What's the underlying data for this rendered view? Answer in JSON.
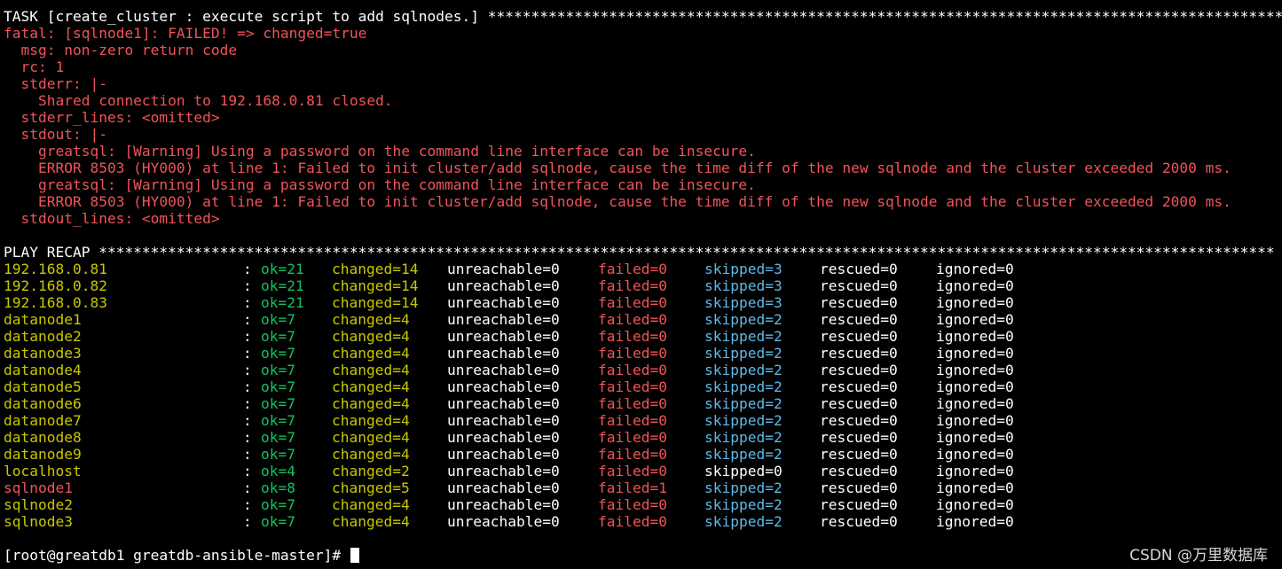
{
  "task_header": "TASK [create_cluster : execute script to add sqlnodes.] **********************************************************************************************",
  "error_lines": [
    "fatal: [sqlnode1]: FAILED! => changed=true",
    "  msg: non-zero return code",
    "  rc: 1",
    "  stderr: |-",
    "    Shared connection to 192.168.0.81 closed.",
    "  stderr_lines: <omitted>",
    "  stdout: |-",
    "    greatsql: [Warning] Using a password on the command line interface can be insecure.",
    "    ERROR 8503 (HY000) at line 1: Failed to init cluster/add sqlnode, cause the time diff of the new sqlnode and the cluster exceeded 2000 ms.",
    "    greatsql: [Warning] Using a password on the command line interface can be insecure.",
    "    ERROR 8503 (HY000) at line 1: Failed to init cluster/add sqlnode, cause the time diff of the new sqlnode and the cluster exceeded 2000 ms.",
    "  stdout_lines: <omitted>"
  ],
  "recap_header": "PLAY RECAP ****************************************************************************************************************************************",
  "recap": [
    {
      "host": "192.168.0.81",
      "host_color": "yellow",
      "ok": "ok=21",
      "changed": "changed=14",
      "unreachable": "unreachable=0",
      "failed": "failed=0",
      "skipped": "skipped=3",
      "skipped_color": "cyan",
      "rescued": "rescued=0",
      "ignored": "ignored=0"
    },
    {
      "host": "192.168.0.82",
      "host_color": "yellow",
      "ok": "ok=21",
      "changed": "changed=14",
      "unreachable": "unreachable=0",
      "failed": "failed=0",
      "skipped": "skipped=3",
      "skipped_color": "cyan",
      "rescued": "rescued=0",
      "ignored": "ignored=0"
    },
    {
      "host": "192.168.0.83",
      "host_color": "yellow",
      "ok": "ok=21",
      "changed": "changed=14",
      "unreachable": "unreachable=0",
      "failed": "failed=0",
      "skipped": "skipped=3",
      "skipped_color": "cyan",
      "rescued": "rescued=0",
      "ignored": "ignored=0"
    },
    {
      "host": "datanode1",
      "host_color": "yellow",
      "ok": "ok=7",
      "changed": "changed=4",
      "unreachable": "unreachable=0",
      "failed": "failed=0",
      "skipped": "skipped=2",
      "skipped_color": "cyan",
      "rescued": "rescued=0",
      "ignored": "ignored=0"
    },
    {
      "host": "datanode2",
      "host_color": "yellow",
      "ok": "ok=7",
      "changed": "changed=4",
      "unreachable": "unreachable=0",
      "failed": "failed=0",
      "skipped": "skipped=2",
      "skipped_color": "cyan",
      "rescued": "rescued=0",
      "ignored": "ignored=0"
    },
    {
      "host": "datanode3",
      "host_color": "yellow",
      "ok": "ok=7",
      "changed": "changed=4",
      "unreachable": "unreachable=0",
      "failed": "failed=0",
      "skipped": "skipped=2",
      "skipped_color": "cyan",
      "rescued": "rescued=0",
      "ignored": "ignored=0"
    },
    {
      "host": "datanode4",
      "host_color": "yellow",
      "ok": "ok=7",
      "changed": "changed=4",
      "unreachable": "unreachable=0",
      "failed": "failed=0",
      "skipped": "skipped=2",
      "skipped_color": "cyan",
      "rescued": "rescued=0",
      "ignored": "ignored=0"
    },
    {
      "host": "datanode5",
      "host_color": "yellow",
      "ok": "ok=7",
      "changed": "changed=4",
      "unreachable": "unreachable=0",
      "failed": "failed=0",
      "skipped": "skipped=2",
      "skipped_color": "cyan",
      "rescued": "rescued=0",
      "ignored": "ignored=0"
    },
    {
      "host": "datanode6",
      "host_color": "yellow",
      "ok": "ok=7",
      "changed": "changed=4",
      "unreachable": "unreachable=0",
      "failed": "failed=0",
      "skipped": "skipped=2",
      "skipped_color": "cyan",
      "rescued": "rescued=0",
      "ignored": "ignored=0"
    },
    {
      "host": "datanode7",
      "host_color": "yellow",
      "ok": "ok=7",
      "changed": "changed=4",
      "unreachable": "unreachable=0",
      "failed": "failed=0",
      "skipped": "skipped=2",
      "skipped_color": "cyan",
      "rescued": "rescued=0",
      "ignored": "ignored=0"
    },
    {
      "host": "datanode8",
      "host_color": "yellow",
      "ok": "ok=7",
      "changed": "changed=4",
      "unreachable": "unreachable=0",
      "failed": "failed=0",
      "skipped": "skipped=2",
      "skipped_color": "cyan",
      "rescued": "rescued=0",
      "ignored": "ignored=0"
    },
    {
      "host": "datanode9",
      "host_color": "yellow",
      "ok": "ok=7",
      "changed": "changed=4",
      "unreachable": "unreachable=0",
      "failed": "failed=0",
      "skipped": "skipped=2",
      "skipped_color": "cyan",
      "rescued": "rescued=0",
      "ignored": "ignored=0"
    },
    {
      "host": "localhost",
      "host_color": "yellow",
      "ok": "ok=4",
      "changed": "changed=2",
      "unreachable": "unreachable=0",
      "failed": "failed=0",
      "skipped": "skipped=0",
      "skipped_color": "white",
      "rescued": "rescued=0",
      "ignored": "ignored=0"
    },
    {
      "host": "sqlnode1",
      "host_color": "red",
      "ok": "ok=8",
      "changed": "changed=5",
      "unreachable": "unreachable=0",
      "failed": "failed=1",
      "skipped": "skipped=2",
      "skipped_color": "cyan",
      "rescued": "rescued=0",
      "ignored": "ignored=0"
    },
    {
      "host": "sqlnode2",
      "host_color": "yellow",
      "ok": "ok=7",
      "changed": "changed=4",
      "unreachable": "unreachable=0",
      "failed": "failed=0",
      "skipped": "skipped=2",
      "skipped_color": "cyan",
      "rescued": "rescued=0",
      "ignored": "ignored=0"
    },
    {
      "host": "sqlnode3",
      "host_color": "yellow",
      "ok": "ok=7",
      "changed": "changed=4",
      "unreachable": "unreachable=0",
      "failed": "failed=0",
      "skipped": "skipped=2",
      "skipped_color": "cyan",
      "rescued": "rescued=0",
      "ignored": "ignored=0"
    }
  ],
  "prompt": "[root@greatdb1 greatdb-ansible-master]# ",
  "watermark": "CSDN @万里数据库",
  "colors": {
    "white": "#ffffff",
    "red": "#f0545a",
    "yellow": "#c8c800",
    "green": "#16c060",
    "cyan": "#5fb8e6",
    "background": "#000000"
  }
}
